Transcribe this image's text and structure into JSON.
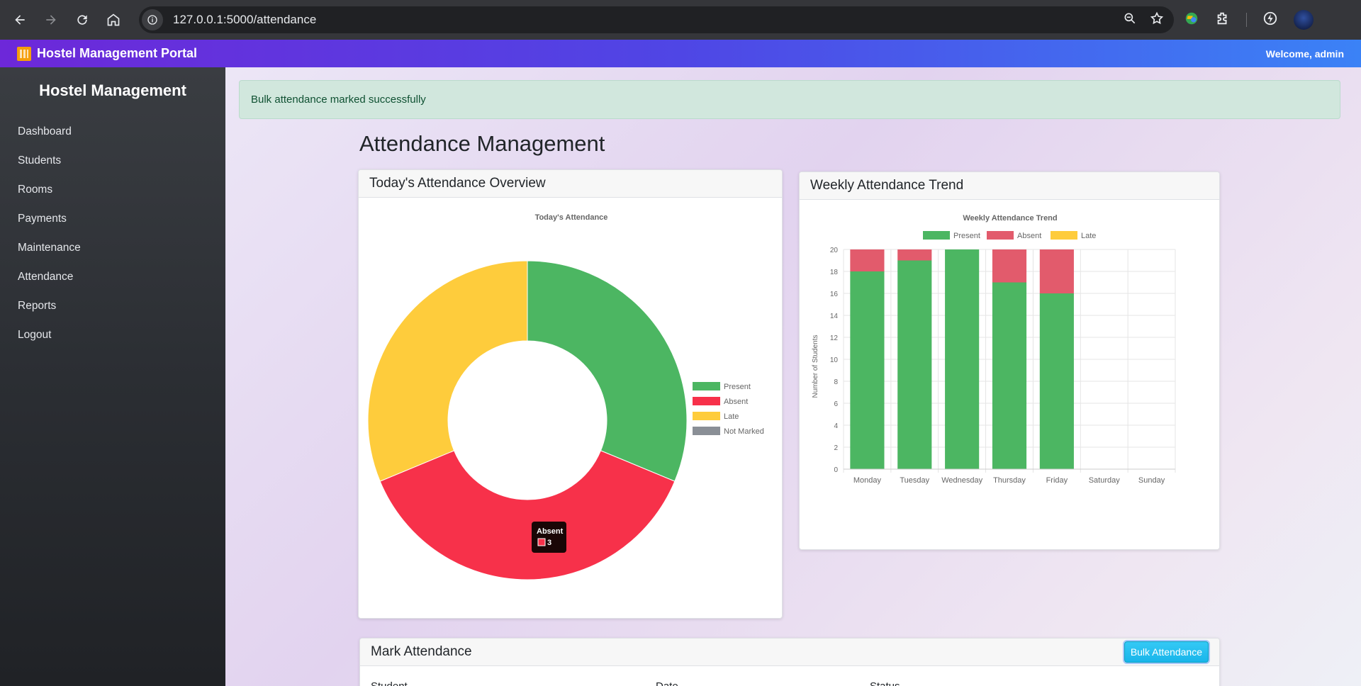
{
  "browser": {
    "url": "127.0.0.1:5000/attendance"
  },
  "header": {
    "brand": "Hostel Management Portal",
    "welcome": "Welcome, admin"
  },
  "sidebar": {
    "title": "Hostel Management",
    "items": [
      {
        "label": "Dashboard"
      },
      {
        "label": "Students"
      },
      {
        "label": "Rooms"
      },
      {
        "label": "Payments"
      },
      {
        "label": "Maintenance"
      },
      {
        "label": "Attendance"
      },
      {
        "label": "Reports"
      },
      {
        "label": "Logout"
      }
    ]
  },
  "alert": {
    "message": "Bulk attendance marked successfully"
  },
  "page": {
    "title": "Attendance Management"
  },
  "today_card": {
    "header": "Today's Attendance Overview"
  },
  "weekly_card": {
    "header": "Weekly Attendance Trend"
  },
  "mark_card": {
    "header": "Mark Attendance",
    "bulk_button": "Bulk Attendance",
    "field_labels": [
      "Student",
      "Date",
      "Status"
    ]
  },
  "tooltip": {
    "title": "Absent",
    "value": "3"
  },
  "colors": {
    "present": "#4cb662",
    "absent": "#f7314a",
    "absent_bar": "#e25b6c",
    "late": "#fecc3c",
    "not_marked": "#8a8f96",
    "accent": "#4f46e5"
  },
  "chart_data": [
    {
      "type": "pie",
      "title": "Today's Attendance",
      "categories": [
        "Present",
        "Absent",
        "Late",
        "Not Marked"
      ],
      "values": [
        2.5,
        3,
        2.5,
        0
      ],
      "colors": [
        "#4cb662",
        "#f7314a",
        "#fecc3c",
        "#8a8f96"
      ],
      "legend": "right"
    },
    {
      "type": "bar",
      "stacked": true,
      "title": "Weekly Attendance Trend",
      "ylabel": "Number of Students",
      "xlabel": "",
      "categories": [
        "Monday",
        "Tuesday",
        "Wednesday",
        "Thursday",
        "Friday",
        "Saturday",
        "Sunday"
      ],
      "ylim": [
        0,
        20
      ],
      "yticks": [
        0,
        2,
        4,
        6,
        8,
        10,
        12,
        14,
        16,
        18,
        20
      ],
      "grid": true,
      "legend": "top",
      "series": [
        {
          "name": "Present",
          "color": "#4cb662",
          "values": [
            18,
            19,
            20,
            17,
            16,
            0,
            0
          ]
        },
        {
          "name": "Absent",
          "color": "#e25b6c",
          "values": [
            2,
            1,
            0,
            3,
            4,
            0,
            0
          ]
        },
        {
          "name": "Late",
          "color": "#fecc3c",
          "values": [
            0,
            0,
            0,
            0,
            0,
            0,
            0
          ]
        }
      ]
    }
  ]
}
